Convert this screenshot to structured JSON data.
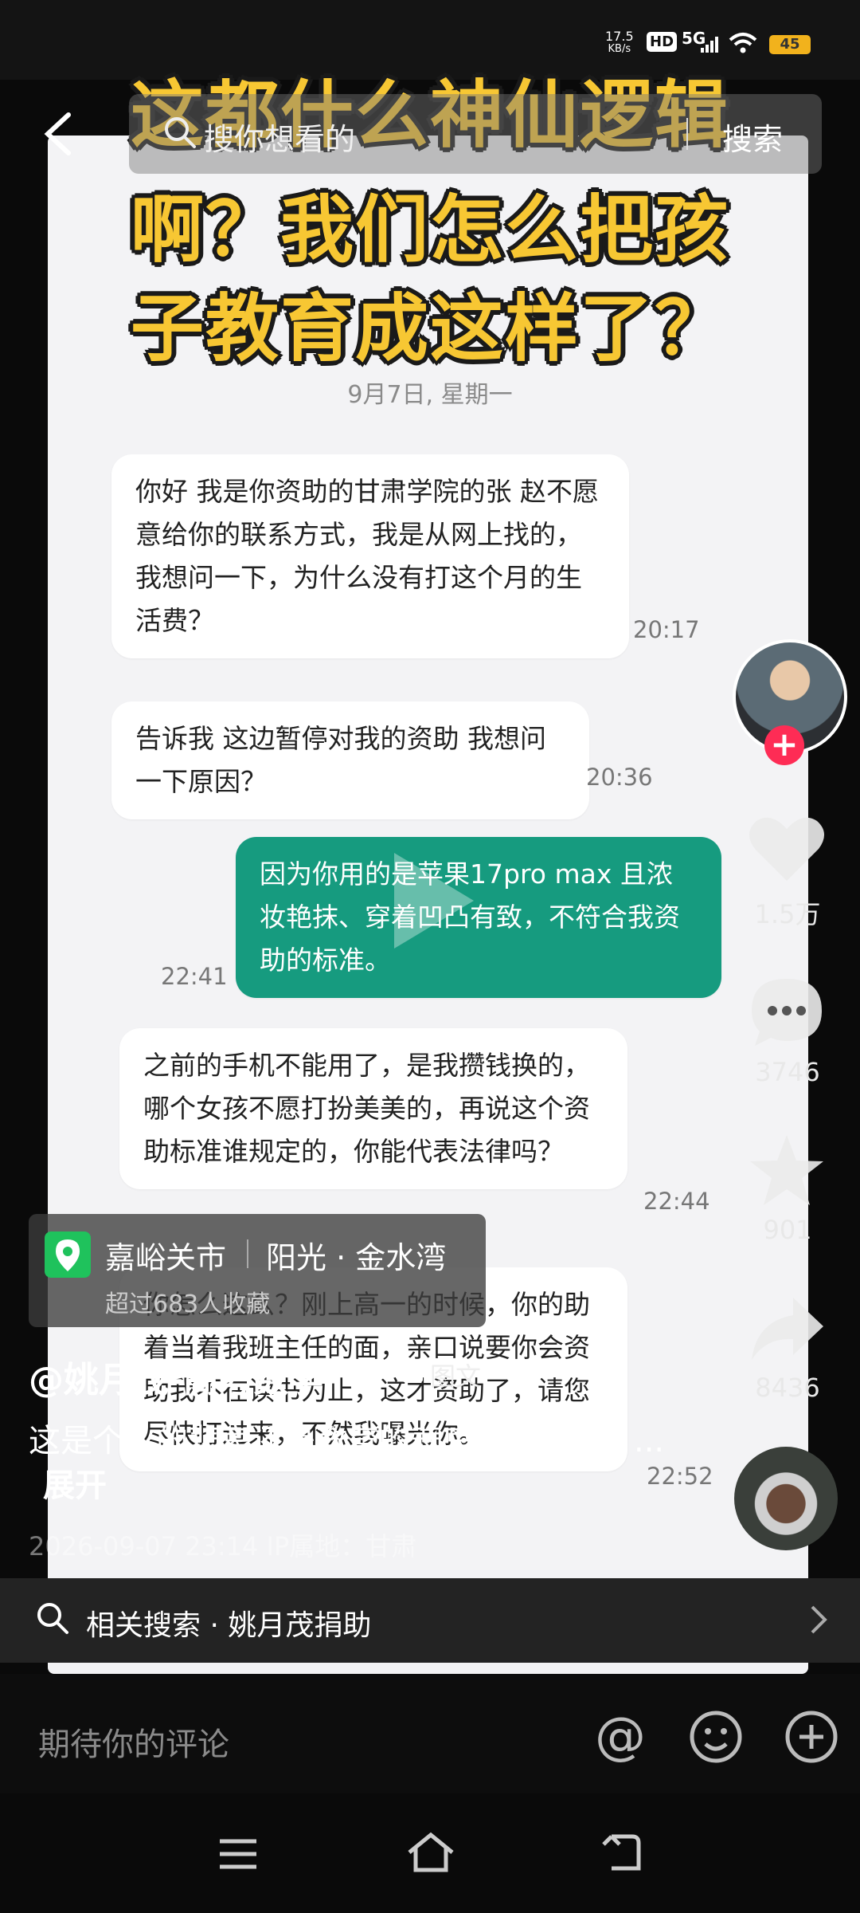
{
  "status": {
    "net_speed": "17.5",
    "net_unit": "KB/s",
    "hd": "HD",
    "signal": "5G",
    "battery": "45"
  },
  "search": {
    "placeholder": "搜你想看的",
    "button": "搜索"
  },
  "overlay_title": {
    "line1": "这都什么神仙逻辑",
    "line2": "啊？我们怎么把孩",
    "line3": "子教育成这样了？"
  },
  "chat": {
    "date": "9月7日, 星期一",
    "messages": [
      {
        "text": "你好 我是你资助的甘肃学院的张 赵不愿意给你的联系方式，我是从网上找的，我想问一下，为什么没有打这个月的生活费？",
        "time": "20:17"
      },
      {
        "text": "告诉我 这边暂停对我的资助 我想问一下原因？",
        "time": "20:36"
      },
      {
        "text": "因为你用的是苹果17pro max 且浓妆艳抹、穿着凹凸有致，不符合我资助的标准。",
        "time": "22:41"
      },
      {
        "text": "之前的手机不能用了，是我攒钱换的，哪个女孩不愿打扮美美的，再说这个资助标准谁规定的，你能代表法律吗？",
        "time": "22:44"
      },
      {
        "text": "你怎么这么？刚上高一的时候，你的助着当着我班主任的面，亲口说要你会资助我不在读书为止，这才资助了，请您尽快打过来，不然我曝光你。",
        "time": "22:52"
      }
    ]
  },
  "rail": {
    "likes": "1.5万",
    "comments": "3746",
    "favorites": "901",
    "shares": "8436"
  },
  "location": {
    "city": "嘉峪关市",
    "place": "阳光 · 金水湾",
    "sub": "超过683人收藏"
  },
  "post": {
    "author": "@姚月茂-高考数学",
    "type_tag": "图文",
    "caption": "这是个人的悲哀还是教育的悲哀，亦或是？...",
    "expand": "展开",
    "meta": "2026-09-07 23:14  IP属地：甘肃"
  },
  "related": {
    "label": "相关搜索 · 姚月茂捐助"
  },
  "comment": {
    "placeholder": "期待你的评论"
  },
  "colors": {
    "accent_red": "#fe2c55",
    "title_yellow": "#f7c733",
    "bubble_green": "#169b7f"
  }
}
